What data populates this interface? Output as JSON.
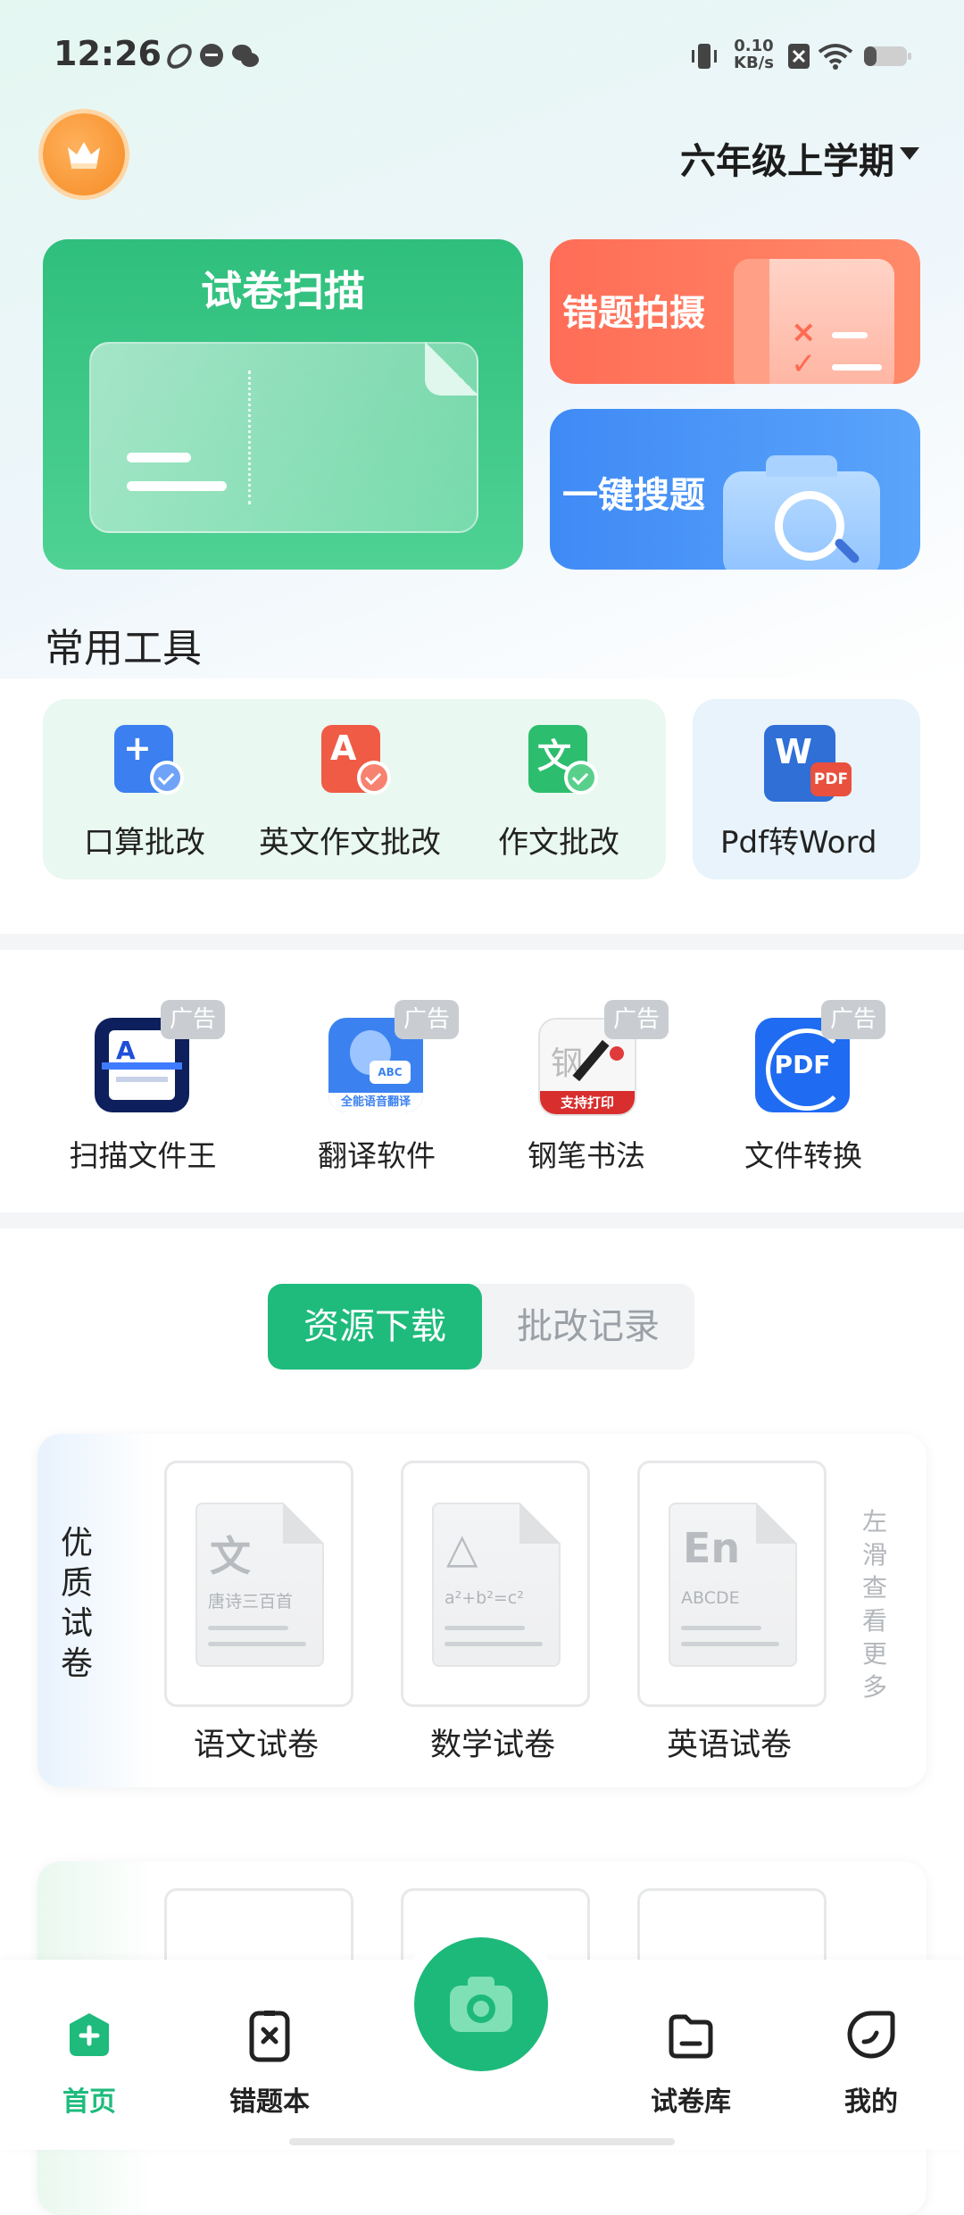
{
  "status_bar": {
    "time": "12:26",
    "net_speed_value": "0.10",
    "net_speed_unit": "KB/s",
    "icons": [
      "link-icon",
      "message-icon",
      "wechat-icon",
      "vibrate-icon",
      "sim-off-icon",
      "wifi-icon",
      "battery-icon"
    ]
  },
  "header": {
    "grade": "六年级上学期"
  },
  "hero": {
    "scan": "试卷扫描",
    "mistake_photo": "错题拍摄",
    "search": "一键搜题"
  },
  "tools": {
    "title": "常用工具",
    "items": [
      {
        "label": "口算批改",
        "icon": "math-check-icon",
        "color": "#3b7ff0"
      },
      {
        "label": "英文作文批改",
        "icon": "english-check-icon",
        "color": "#f05b46"
      },
      {
        "label": "作文批改",
        "icon": "essay-check-icon",
        "color": "#2dbd6e"
      },
      {
        "label": "Pdf转Word",
        "icon": "word-pdf-icon",
        "color": "#2f6fd6"
      }
    ]
  },
  "ads": {
    "badge": "广告",
    "apps": [
      {
        "label": "扫描文件王",
        "icon_text": "A"
      },
      {
        "label": "翻译软件",
        "icon_text": "全能语音翻译"
      },
      {
        "label": "钢笔书法",
        "icon_text": "支持打印"
      },
      {
        "label": "文件转换",
        "icon_text": "PDF"
      }
    ]
  },
  "segment": {
    "active": "资源下载",
    "inactive": "批改记录"
  },
  "resources": {
    "section_title": "优质试卷",
    "hint": "左滑查看更多",
    "items": [
      {
        "label": "语文试卷",
        "glyph": "文",
        "sub": "唐诗三百首"
      },
      {
        "label": "数学试卷",
        "glyph": "△",
        "sub": "a²+b²=c²"
      },
      {
        "label": "英语试卷",
        "glyph": "En",
        "sub": "ABCDE"
      }
    ]
  },
  "bottom_nav": {
    "home": "首页",
    "mistakes": "错题本",
    "library": "试卷库",
    "mine": "我的"
  },
  "colors": {
    "accent": "#1ebb7c",
    "mistake_card": "#ff7a60",
    "search_card": "#4b97f8"
  }
}
